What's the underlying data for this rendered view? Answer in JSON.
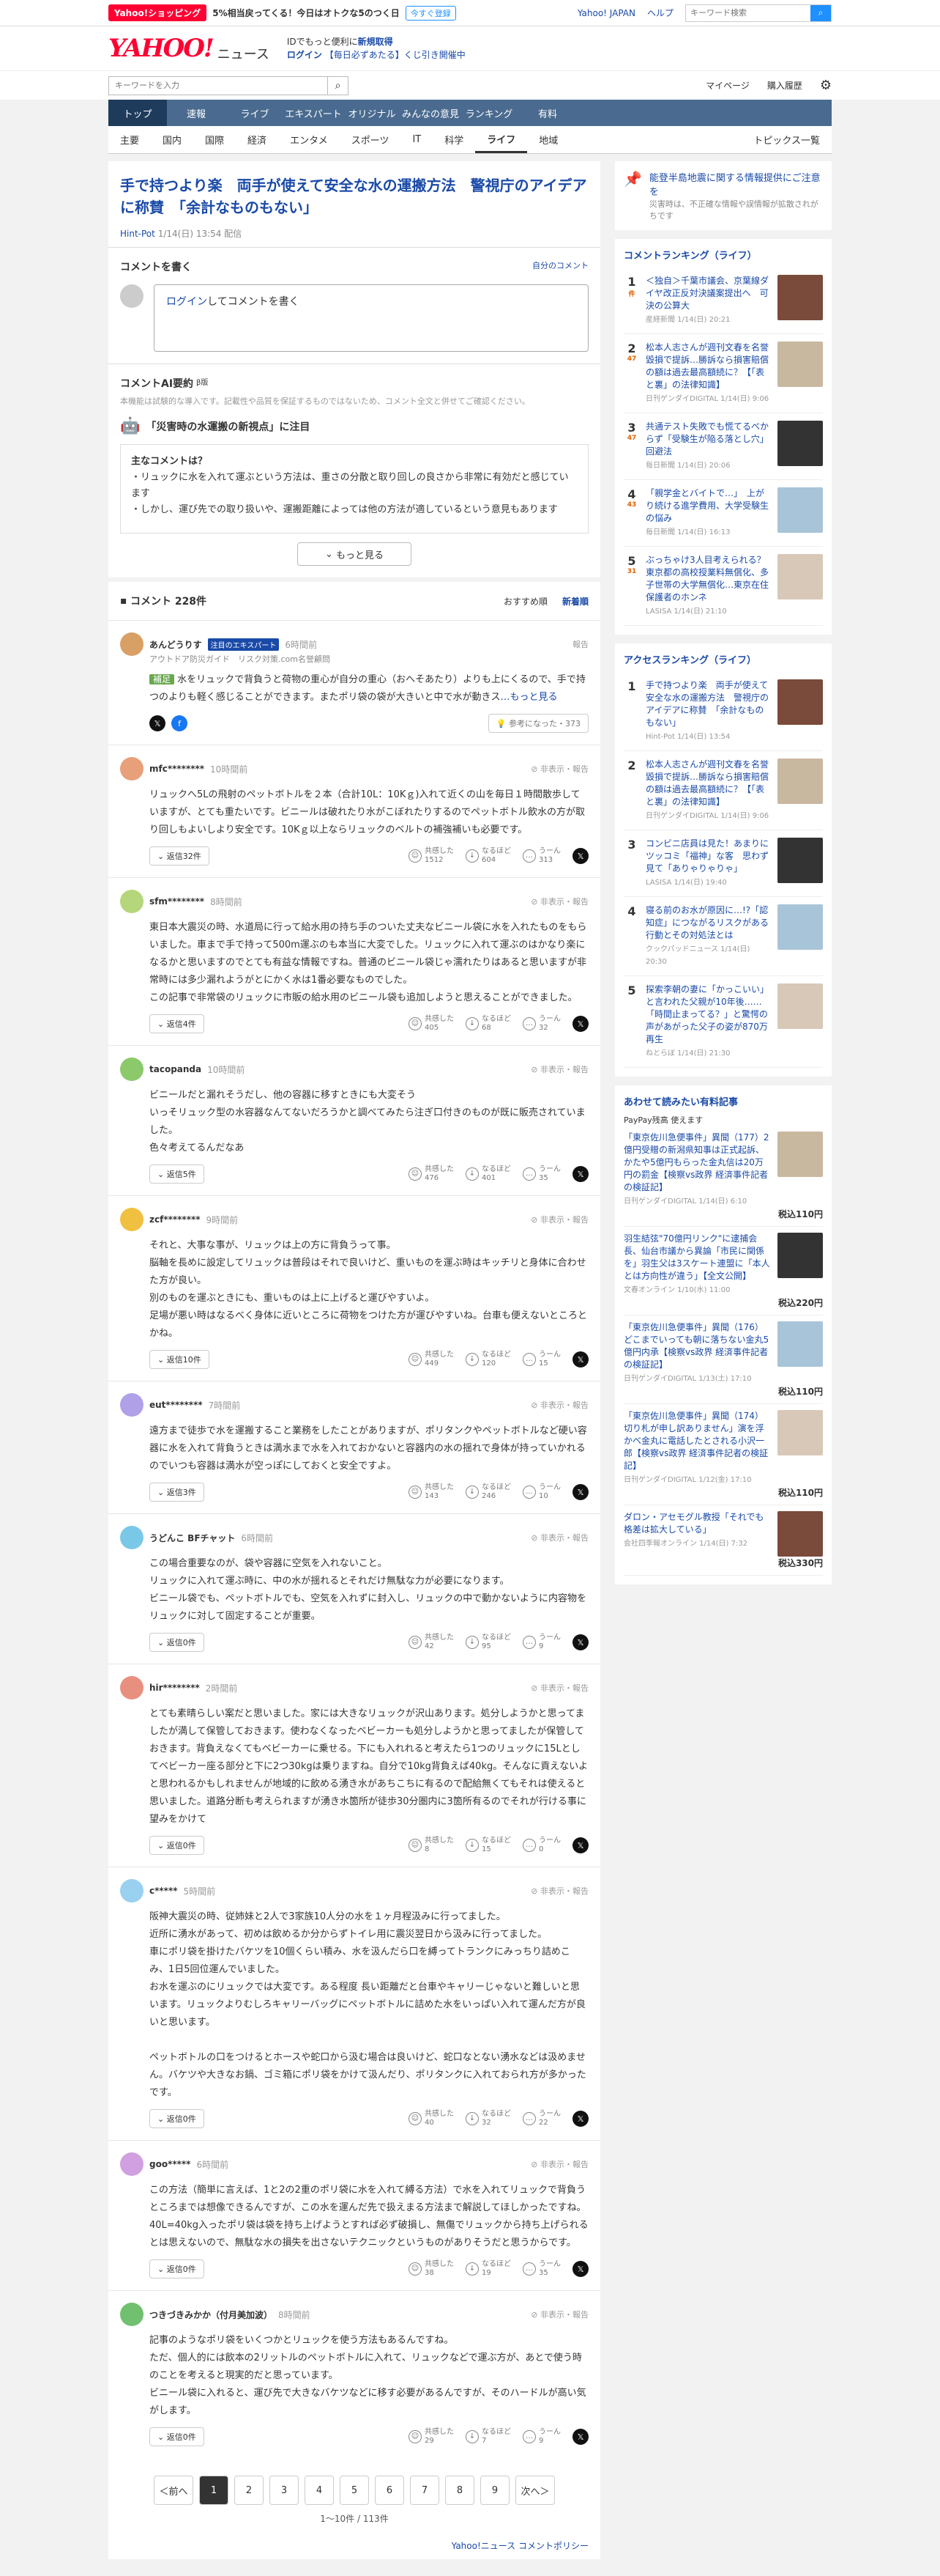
{
  "topbar": {
    "badge": "Yahoo!ショッピング",
    "promo": "5%相当戻ってくる！今日はオトクな5のつく日",
    "promo_btn": "今すぐ登録",
    "links": [
      "Yahoo! JAPAN",
      "ヘルプ"
    ],
    "search_placeholder": "キーワード検索"
  },
  "header": {
    "logo": "YAHOO!",
    "logo_sub": "JAPAN",
    "news": "ニュース",
    "line1": "IDでもっと便利に",
    "line1b": "新規取得",
    "login": "ログイン",
    "line2": "【毎日必ずあたる】くじ引き開催中"
  },
  "bar2": {
    "placeholder": "キーワードを入力",
    "links": [
      "マイページ",
      "購入履歴"
    ]
  },
  "nav1": [
    "トップ",
    "速報",
    "ライブ",
    "エキスパート",
    "オリジナル",
    "みんなの意見",
    "ランキング",
    "有料"
  ],
  "nav2": [
    "主要",
    "国内",
    "国際",
    "経済",
    "エンタメ",
    "スポーツ",
    "IT",
    "科学",
    "ライフ",
    "地域"
  ],
  "nav2_topics": "トピックス一覧",
  "article": {
    "title": "手で持つより楽　両手が使えて安全な水の運搬方法　警視庁のアイデアに称賛　「余計なものもない」",
    "source": "Hint-Pot",
    "date": "1/14(日) 13:54 配信"
  },
  "comment_form": {
    "heading": "コメントを書く",
    "own": "自分のコメント",
    "login": "ログイン",
    "placeholder": "してコメントを書く"
  },
  "ai": {
    "heading": "コメントAI要約",
    "beta": "β版",
    "disclaimer": "本機能は試験的な導入です。記載性や品質を保証するものではないため、コメント全文と併せてご確認ください。",
    "topic": "「災害時の水運搬の新視点」に注目",
    "main_q": "主なコメントは？",
    "bullets": [
      "リュックに水を入れて運ぶという方法は、重さの分散と取り回しの良さから非常に有効だと感じています",
      "しかし、運び先での取り扱いや、運搬距離によっては他の方法が適しているという意見もあります"
    ],
    "more": "もっと見る"
  },
  "comments_head": {
    "count": "コメント 228件",
    "sort1": "おすすめ順",
    "sort2": "新着順"
  },
  "expert": {
    "name": "あんどうりす",
    "badge": "注目のエキスパート",
    "time": "6時間前",
    "role": "アウトドア防災ガイド　リスク対策.com名誉顧問",
    "report": "報告",
    "tag": "補足",
    "text": "水をリュックで背負うと荷物の重心が自分の重心（おへそあたり）よりも上にくるので、手で持つのよりも軽く感じることができます。またポリ袋の袋が大きいと中で水が動きス",
    "more": "…もっと見る",
    "useful": "参考になった",
    "useful_n": "373"
  },
  "comments": [
    {
      "name": "mfc********",
      "time": "10時間前",
      "text": "リュックへ5Lの飛射のペットボトルを２本（合計10L：10Kｇ)入れて近くの山を毎日１時間散歩していますが、とても重たいです。ビニールは破れたり水がこぼれたりするのでペットボトル飲水の方が取り回しもよいしより安全です。10Kｇ以上ならリュックのベルトの補強補いも必要です。",
      "replies": "返信32件",
      "a": "1512",
      "b": "604",
      "c": "313"
    },
    {
      "name": "sfm********",
      "time": "8時間前",
      "text": "東日本大震災の時、水道局に行って給水用の持ち手のついた丈夫なビニール袋に水を入れたものをもらいました。車まで手で持って500m運ぶのも本当に大変でした。リュックに入れて運ぶのはかなり楽になるかと思いますのでとても有益な情報ですね。普通のビニール袋じゃ濡れたりはあると思いますが非常時には多少漏れようがとにかく水は1番必要なものでした。\nこの記事で非常袋のリュックに市販の給水用のビニール袋も追加しようと思えることができました。",
      "replies": "返信4件",
      "a": "405",
      "b": "68",
      "c": "32"
    },
    {
      "name": "tacopanda",
      "time": "10時間前",
      "text": "ビニールだと漏れそうだし、他の容器に移すときにも大変そう\nいっそリュック型の水容器なんてないだろうかと調べてみたら注ぎ口付きのものが既に販売されていました。\n色々考えてるんだなあ",
      "replies": "返信5件",
      "a": "476",
      "b": "401",
      "c": "35"
    },
    {
      "name": "zcf********",
      "time": "9時間前",
      "text": "それと、大事な事が、リュックは上の方に背負うって事。\n脳軸を長めに設定してリュックは普段はそれで良いけど、重いものを運ぶ時はキッチリと身体に合わせた方が良い。\n別のものを運ぶときにも、重いものは上に上げると運びやすいよ。\n足場が悪い時はなるべく身体に近いところに荷物をつけた方が運びやすいね。台車も便えないところとかね。",
      "replies": "返信10件",
      "a": "449",
      "b": "120",
      "c": "15"
    },
    {
      "name": "eut********",
      "time": "7時間前",
      "text": "遠方まで徒歩で水を運搬すること業務をしたことがありますが、ポリタンクやペットボトルなど硬い容器に水を入れて背負うときは満水まで水を入れておかないと容器内の水の揺れで身体が持っていかれるのでいつも容器は満水が空っぽにしておくと安全ですよ。",
      "replies": "返信3件",
      "a": "143",
      "b": "246",
      "c": "10"
    },
    {
      "name": "うどんこ BFチャット",
      "time": "6時間前",
      "text": "この場合重要なのが、袋や容器に空気を入れないこと。\nリュックに入れて運ぶ時に、中の水が揺れるとそれだけ無駄な力が必要になります。\nビニール袋でも、ペットボトルでも、空気を入れずに封入し、リュックの中で動かないように内容物をリュックに対して固定することが重要。",
      "replies": "返信0件",
      "a": "42",
      "b": "95",
      "c": "9"
    },
    {
      "name": "hir********",
      "time": "2時間前",
      "text": "とても素晴らしい案だと思いました。家には大きなリュックが沢山あります。処分しようかと思ってましたが満して保管しておきます。使わなくなったベビーカーも処分しようかと思ってましたが保管しておきます。背負えなくてもベビーカーに乗せる。下にも入れれると考えたら1つのリュックに15Lとしてベビーカー座る部分と下に2つ30kgは乗りますね。自分で10kg背負えば40kg。そんなに貢えないよと思われるかもしれませんが地域的に飲める湧き水があちこちに有るので配給無くてもそれは使えると思いました。道路分断も考えられますが湧き水箇所が徒歩30分圏内に3箇所有るのでそれが行ける事に望みをかけて",
      "replies": "返信0件",
      "a": "8",
      "b": "15",
      "c": "0"
    },
    {
      "name": "c*****",
      "time": "5時間前",
      "text": "阪神大震災の時、従姉妹と2人で3家族10人分の水を１ヶ月程汲みに行ってました。\n近所に湧水があって、初めは飲めるか分からずトイレ用に震災翌日から汲みに行ってました。\n車にポリ袋を掛けたバケツを10個くらい積み、水を汲んだら口を縛ってトランクにみっちり詰めこみ、1日5回位運んでいました。\n お水を運ぶのにリュックでは大変です。ある程度 長い距離だと台車やキャリーじゃないと難しいと思います。リュックよりむしろキャリーバッグにペットボトルに詰めた水をいっぱい入れて運んだ方が良いと思います。\n\nペットボトルの口をつけるとホースや蛇口から汲む場合は良いけど、蛇口なとない湧水などは汲めません。バケツや大きなお鍋、ゴミ箱にポリ袋をかけて汲んだり、ポリタンクに入れておられ方が多かったです。",
      "replies": "返信0件",
      "a": "40",
      "b": "32",
      "c": "22"
    },
    {
      "name": "goo*****",
      "time": "6時間前",
      "text": "この方法（簡単に言えば、1と2の2重のポリ袋に水を入れて縛る方法）で水を入れてリュックで背負うところまでは想像できるんですが、この水を運んだ先で扱えまる方法まで解説してほしかったですね。\n40L=40kg入ったポリ袋は袋を持ち上げようとすれば必ず破損し、無傷でリュックから持ち上げられるとは思えないので、無駄な水の損失を出さないテクニックというものがありそうだと思うからです。",
      "replies": "返信0件",
      "a": "38",
      "b": "19",
      "c": "35"
    },
    {
      "name": "つきづきみかか（付月美加波）",
      "time": "8時間前",
      "text": "記事のようなポリ袋をいくつかとリュックを使う方法もあるんですね。\nただ、個人的には飲本の2リットルのペットボトルに入れて、リュックなどで運ぶ方が、あとで使う時のことを考えると現実的だと思っています。\nビニール袋に入れると、運び先で大きなバケツなどに移す必要があるんですが、そのハードルが高い気がします。",
      "replies": "返信0件",
      "a": "29",
      "b": "7",
      "c": "9"
    }
  ],
  "reaction_labels": {
    "a": "共感した",
    "b": "なるほど",
    "c": "うーん"
  },
  "pager": {
    "prev": "＜前へ",
    "pages": [
      "1",
      "2",
      "3",
      "4",
      "5",
      "6",
      "7",
      "8",
      "9"
    ],
    "next": "次へ＞",
    "info": "1〜10件 / 113件",
    "policy": "Yahoo!ニュース コメントポリシー"
  },
  "side": {
    "notice_title": "能登半島地震に関する情報提供にご注意を",
    "notice_text": "災害時は、不正確な情報や誤情報が拡散されがちです",
    "rank1_heading": "コメントランキング（ライフ）",
    "rank1": [
      {
        "n": "1",
        "c": "件",
        "t": "＜独自＞千葉市議会、京葉線ダイヤ改正反対決議案提出へ　可決の公算大",
        "s": "産経新聞 1/14(日) 20:21"
      },
      {
        "n": "2",
        "c": "47",
        "t": "松本人志さんが週刊文春を名誉毀損で提訴…勝訴なら損害賠償の額は過去最高額続に？【「表と裏」の法律知識】",
        "s": "日刊ゲンダイDIGITAL 1/14(日) 9:06"
      },
      {
        "n": "3",
        "c": "47",
        "t": "共通テスト失敗でも慌てるべからず「受験生が陥る落とし穴」回避法",
        "s": "毎日新聞 1/14(日) 20:06"
      },
      {
        "n": "4",
        "c": "43",
        "t": "「親学金とバイトで…」　上がり続ける進学費用、大学受験生の悩み",
        "s": "毎日新聞 1/14(日) 16:13"
      },
      {
        "n": "5",
        "c": "31",
        "t": "ぶっちゃけ3人目考えられる？東京都の高校授業料無償化、多子世帯の大学無償化…東京在住保護者のホンネ",
        "s": "LASISA 1/14(日) 21:10"
      }
    ],
    "rank2_heading": "アクセスランキング（ライフ）",
    "rank2": [
      {
        "n": "1",
        "t": "手で持つより楽　両手が使えて安全な水の運搬方法　警視庁のアイデアに称賛　「余計なものもない」",
        "s": "Hint-Pot 1/14(日) 13:54"
      },
      {
        "n": "2",
        "t": "松本人志さんが週刊文春を名誉毀損で提訴…勝訴なら損害賠償の額は過去最高額続に？【「表と裏」の法律知識】",
        "s": "日刊ゲンダイDIGITAL 1/14(日) 9:06"
      },
      {
        "n": "3",
        "t": "コンビニ店員は見た！あまりにツッコミ「福神」な客　思わず見て「ありゃりゃりゃ」",
        "s": "LASISA 1/14(日) 19:40"
      },
      {
        "n": "4",
        "t": "寝る前のお水が原因に…!?「認知症」につながるリスクがある行動とその対処法とは",
        "s": "クックパッドニュース 1/14(日) 20:30"
      },
      {
        "n": "5",
        "t": "探索李朝の妻に「かっこいい」と言われた父親が10年後……「時間止まってる？」と驚愕の声があがった父子の姿が870万再生",
        "s": "ねとらぼ 1/14(日) 21:30"
      }
    ],
    "paid_heading": "あわせて読みたい有料記事",
    "paypay": "PayPay残高 使えます",
    "paid": [
      {
        "t": "「東京佐川急便事件」異聞（177）2億円受贈の新潟県知事は正式起訴、かたや5億円もらった金丸信は20万円の罰金【検察vs政界 経済事件記者の検証記】",
        "s": "日刊ゲンダイDIGITAL 1/14(日) 6:10",
        "p": "税込110円"
      },
      {
        "t": "羽生結弦\"70億円リンク\"に逮捕会長、仙台市議から異論「市民に関係を」羽生父は3スケート連盟に「本人とは方向性が違う」【全文公開】",
        "s": "文春オンライン 1/10(水) 11:00",
        "p": "税込220円"
      },
      {
        "t": "「東京佐川急便事件」異聞（176）どこまでいっても朝に落ちない金丸5億円内承【検察vs政界 経済事件記者の検証記】",
        "s": "日刊ゲンダイDIGITAL 1/13(土) 17:10",
        "p": "税込110円"
      },
      {
        "t": "「東京佐川急便事件」異聞（174）切り札が申し訳ありません」演を浮かべ金丸に電話したとされる小沢一郎【検察vs政界 経済事件記者の検証記】",
        "s": "日刊ゲンダイDIGITAL 1/12(金) 17:10",
        "p": "税込110円"
      },
      {
        "t": "ダロン・アセモグル教授「それでも格差は拡大している」",
        "s": "会社四季報オンライン 1/14(日) 7:32",
        "p": "税込330円"
      }
    ]
  },
  "colors": {
    "accent": "#1a4aa8",
    "nav": "#4a6b8f",
    "brand": "#ff0033"
  }
}
